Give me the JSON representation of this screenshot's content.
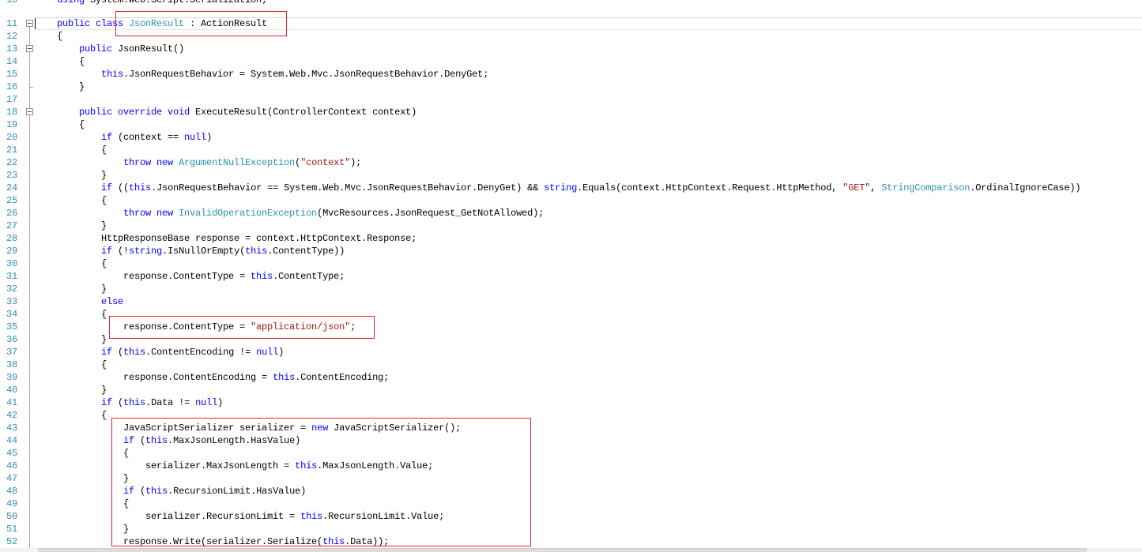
{
  "syntax_colors": {
    "keyword": "#0000ff",
    "type": "#2b91af",
    "string": "#a31515",
    "plain": "#000000",
    "line_number": "#2b91af"
  },
  "annotation_color": "#e3242b",
  "editor": {
    "lines": [
      {
        "n": "10",
        "tokens": [
          {
            "keyword": "    using"
          },
          {
            "plain": " System.Web.Script.Serialization;"
          }
        ]
      },
      {
        "n": "11",
        "fold": true,
        "tokens": [
          {
            "keyword": "    public class"
          },
          {
            "type": " JsonResult"
          },
          {
            "plain": " : ActionResult"
          }
        ]
      },
      {
        "n": "12",
        "tokens": [
          {
            "plain": "    {"
          }
        ]
      },
      {
        "n": "13",
        "fold": true,
        "tokens": [
          {
            "keyword": "        public"
          },
          {
            "plain": " JsonResult()"
          }
        ]
      },
      {
        "n": "14",
        "tokens": [
          {
            "plain": "        {"
          }
        ]
      },
      {
        "n": "15",
        "tokens": [
          {
            "keyword": "            this"
          },
          {
            "plain": ".JsonRequestBehavior = System.Web.Mvc.JsonRequestBehavior.DenyGet;"
          }
        ]
      },
      {
        "n": "16",
        "tokens": [
          {
            "plain": "        }"
          }
        ]
      },
      {
        "n": "17",
        "tokens": []
      },
      {
        "n": "18",
        "fold": true,
        "tokens": [
          {
            "keyword": "        public override void"
          },
          {
            "plain": " ExecuteResult(ControllerContext context)"
          }
        ]
      },
      {
        "n": "19",
        "tokens": [
          {
            "plain": "        {"
          }
        ]
      },
      {
        "n": "20",
        "tokens": [
          {
            "keyword": "            if"
          },
          {
            "plain": " (context == "
          },
          {
            "keyword": "null"
          },
          {
            "plain": ")"
          }
        ]
      },
      {
        "n": "21",
        "tokens": [
          {
            "plain": "            {"
          }
        ]
      },
      {
        "n": "22",
        "tokens": [
          {
            "keyword": "                throw new"
          },
          {
            "type": " ArgumentNullException"
          },
          {
            "plain": "("
          },
          {
            "string": "\"context\""
          },
          {
            "plain": ");"
          }
        ]
      },
      {
        "n": "23",
        "tokens": [
          {
            "plain": "            }"
          }
        ]
      },
      {
        "n": "24",
        "tokens": [
          {
            "keyword": "            if"
          },
          {
            "plain": " (("
          },
          {
            "keyword": "this"
          },
          {
            "plain": ".JsonRequestBehavior == System.Web.Mvc.JsonRequestBehavior.DenyGet) && "
          },
          {
            "keyword": "string"
          },
          {
            "plain": ".Equals(context.HttpContext.Request.HttpMethod, "
          },
          {
            "string": "\"GET\""
          },
          {
            "plain": ", "
          },
          {
            "type": "StringComparison"
          },
          {
            "plain": ".OrdinalIgnoreCase))"
          }
        ]
      },
      {
        "n": "25",
        "tokens": [
          {
            "plain": "            {"
          }
        ]
      },
      {
        "n": "26",
        "tokens": [
          {
            "keyword": "                throw new"
          },
          {
            "type": " InvalidOperationException"
          },
          {
            "plain": "(MvcResources.JsonRequest_GetNotAllowed);"
          }
        ]
      },
      {
        "n": "27",
        "tokens": [
          {
            "plain": "            }"
          }
        ]
      },
      {
        "n": "28",
        "tokens": [
          {
            "plain": "            HttpResponseBase response = context.HttpContext.Response;"
          }
        ]
      },
      {
        "n": "29",
        "tokens": [
          {
            "keyword": "            if"
          },
          {
            "plain": " (!"
          },
          {
            "keyword": "string"
          },
          {
            "plain": ".IsNullOrEmpty("
          },
          {
            "keyword": "this"
          },
          {
            "plain": ".ContentType))"
          }
        ]
      },
      {
        "n": "30",
        "tokens": [
          {
            "plain": "            {"
          }
        ]
      },
      {
        "n": "31",
        "tokens": [
          {
            "plain": "                response.ContentType = "
          },
          {
            "keyword": "this"
          },
          {
            "plain": ".ContentType;"
          }
        ]
      },
      {
        "n": "32",
        "tokens": [
          {
            "plain": "            }"
          }
        ]
      },
      {
        "n": "33",
        "tokens": [
          {
            "keyword": "            else"
          }
        ]
      },
      {
        "n": "34",
        "tokens": [
          {
            "plain": "            {"
          }
        ]
      },
      {
        "n": "35",
        "tokens": [
          {
            "plain": "                response.ContentType = "
          },
          {
            "string": "\"application/json\""
          },
          {
            "plain": ";"
          }
        ]
      },
      {
        "n": "36",
        "tokens": [
          {
            "plain": "            }"
          }
        ]
      },
      {
        "n": "37",
        "tokens": [
          {
            "keyword": "            if"
          },
          {
            "plain": " ("
          },
          {
            "keyword": "this"
          },
          {
            "plain": ".ContentEncoding != "
          },
          {
            "keyword": "null"
          },
          {
            "plain": ")"
          }
        ]
      },
      {
        "n": "38",
        "tokens": [
          {
            "plain": "            {"
          }
        ]
      },
      {
        "n": "39",
        "tokens": [
          {
            "plain": "                response.ContentEncoding = "
          },
          {
            "keyword": "this"
          },
          {
            "plain": ".ContentEncoding;"
          }
        ]
      },
      {
        "n": "40",
        "tokens": [
          {
            "plain": "            }"
          }
        ]
      },
      {
        "n": "41",
        "tokens": [
          {
            "keyword": "            if"
          },
          {
            "plain": " ("
          },
          {
            "keyword": "this"
          },
          {
            "plain": ".Data != "
          },
          {
            "keyword": "null"
          },
          {
            "plain": ")"
          }
        ]
      },
      {
        "n": "42",
        "tokens": [
          {
            "plain": "            {"
          }
        ]
      },
      {
        "n": "43",
        "tokens": [
          {
            "plain": "                JavaScriptSerializer serializer = "
          },
          {
            "keyword": "new"
          },
          {
            "plain": " JavaScriptSerializer();"
          }
        ]
      },
      {
        "n": "44",
        "tokens": [
          {
            "keyword": "                if"
          },
          {
            "plain": " ("
          },
          {
            "keyword": "this"
          },
          {
            "plain": ".MaxJsonLength.HasValue)"
          }
        ]
      },
      {
        "n": "45",
        "tokens": [
          {
            "plain": "                {"
          }
        ]
      },
      {
        "n": "46",
        "tokens": [
          {
            "plain": "                    serializer.MaxJsonLength = "
          },
          {
            "keyword": "this"
          },
          {
            "plain": ".MaxJsonLength.Value;"
          }
        ]
      },
      {
        "n": "47",
        "tokens": [
          {
            "plain": "                }"
          }
        ]
      },
      {
        "n": "48",
        "tokens": [
          {
            "keyword": "                if"
          },
          {
            "plain": " ("
          },
          {
            "keyword": "this"
          },
          {
            "plain": ".RecursionLimit.HasValue)"
          }
        ]
      },
      {
        "n": "49",
        "tokens": [
          {
            "plain": "                {"
          }
        ]
      },
      {
        "n": "50",
        "tokens": [
          {
            "plain": "                    serializer.RecursionLimit = "
          },
          {
            "keyword": "this"
          },
          {
            "plain": ".RecursionLimit.Value;"
          }
        ]
      },
      {
        "n": "51",
        "tokens": [
          {
            "plain": "                }"
          }
        ]
      },
      {
        "n": "52",
        "tokens": [
          {
            "plain": "                response.Write(serializer.Serialize("
          },
          {
            "keyword": "this"
          },
          {
            "plain": ".Data));"
          }
        ]
      }
    ]
  }
}
